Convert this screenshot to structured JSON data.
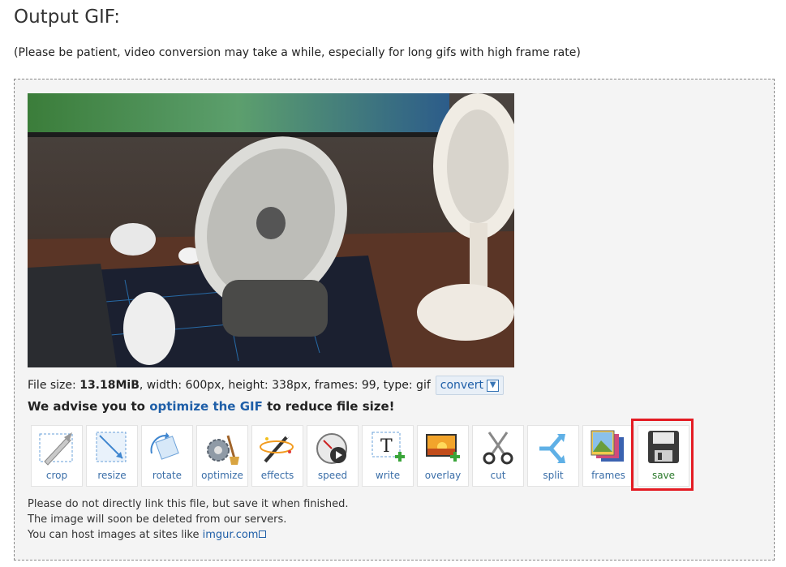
{
  "heading": "Output GIF:",
  "subtitle": "(Please be patient, video conversion may take a while, especially for long gifs with high frame rate)",
  "preview": {
    "description_icon": "gif-preview-image"
  },
  "file_info": {
    "prefix": "File size:",
    "size": "13.18MiB",
    "rest": ", width: 600px, height: 338px, frames: 99, type: gif",
    "convert_label": "convert"
  },
  "advise": {
    "before": "We advise you to",
    "link": "optimize the GIF",
    "after": "to reduce file size!"
  },
  "tools": [
    {
      "label": "crop",
      "icon": "crop-icon"
    },
    {
      "label": "resize",
      "icon": "resize-icon"
    },
    {
      "label": "rotate",
      "icon": "rotate-icon"
    },
    {
      "label": "optimize",
      "icon": "optimize-icon"
    },
    {
      "label": "effects",
      "icon": "effects-icon"
    },
    {
      "label": "speed",
      "icon": "speed-icon"
    },
    {
      "label": "write",
      "icon": "write-icon"
    },
    {
      "label": "overlay",
      "icon": "overlay-icon"
    },
    {
      "label": "cut",
      "icon": "cut-icon"
    },
    {
      "label": "split",
      "icon": "split-icon"
    },
    {
      "label": "frames",
      "icon": "frames-icon"
    },
    {
      "label": "save",
      "icon": "save-icon"
    }
  ],
  "notes": {
    "line1": "Please do not directly link this file, but save it when finished.",
    "line2": "The image will soon be deleted from our servers.",
    "line3_prefix": "You can host images at sites like",
    "line3_link": "imgur.com"
  },
  "colors": {
    "accent": "#1f5fa8",
    "highlight": "#e41b23",
    "save_label": "#2b7a2b"
  }
}
